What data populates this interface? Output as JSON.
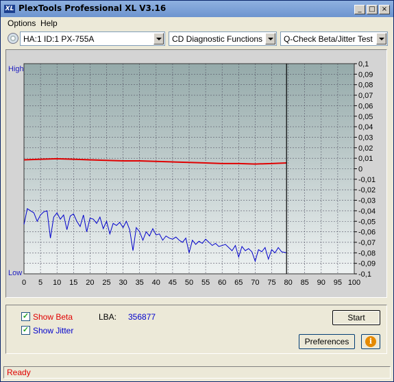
{
  "window": {
    "title": "PlexTools Professional XL V3.16",
    "logo_text": "XL",
    "controls": {
      "minimize": "_",
      "maximize": "□",
      "close": "×"
    }
  },
  "menu": {
    "items": [
      {
        "label": "Options",
        "accel": "O"
      },
      {
        "label": "Help",
        "accel": "H"
      }
    ]
  },
  "toolbar": {
    "drive": "HA:1 ID:1  PX-755A",
    "function": "CD Diagnostic Functions",
    "test": "Q-Check Beta/Jitter Test"
  },
  "chart": {
    "left_labels": {
      "top": "High",
      "bottom": "Low"
    },
    "colors": {
      "beta": "#e00000",
      "jitter": "#0000cc",
      "plot_top": "#95aaaa",
      "plot_bottom": "#eef2f2"
    }
  },
  "chart_data": {
    "type": "line",
    "x_ticks": [
      "0",
      "5",
      "10",
      "15",
      "20",
      "25",
      "30",
      "35",
      "40",
      "45",
      "50",
      "55",
      "60",
      "65",
      "70",
      "75",
      "80",
      "85",
      "90",
      "95",
      "100"
    ],
    "xlim": [
      0,
      100
    ],
    "ylim": [
      -0.1,
      0.1
    ],
    "y_ticks": [
      "0,1",
      "0,09",
      "0,08",
      "0,07",
      "0,06",
      "0,05",
      "0,04",
      "0,03",
      "0,02",
      "0,01",
      "0",
      "-0,01",
      "-0,02",
      "-0,03",
      "-0,04",
      "-0,05",
      "-0,06",
      "-0,07",
      "-0,08",
      "-0,09",
      "-0,1"
    ],
    "marker_x": 79.5,
    "grid": true,
    "series": [
      {
        "name": "Beta",
        "color": "#e00000",
        "x": [
          0,
          5,
          10,
          15,
          20,
          25,
          30,
          35,
          40,
          45,
          50,
          55,
          60,
          65,
          70,
          75,
          79.5
        ],
        "values": [
          0.0085,
          0.009,
          0.0095,
          0.009,
          0.0085,
          0.008,
          0.0075,
          0.0075,
          0.007,
          0.0065,
          0.006,
          0.0055,
          0.005,
          0.005,
          0.0045,
          0.005,
          0.0055
        ]
      },
      {
        "name": "Jitter",
        "color": "#0000cc",
        "x": [
          0,
          1,
          2,
          3,
          4,
          5,
          6,
          7,
          8,
          9,
          10,
          11,
          12,
          13,
          14,
          15,
          16,
          17,
          18,
          19,
          20,
          21,
          22,
          23,
          24,
          25,
          26,
          27,
          28,
          29,
          30,
          31,
          32,
          33,
          34,
          35,
          36,
          37,
          38,
          39,
          40,
          41,
          42,
          43,
          44,
          45,
          46,
          47,
          48,
          49,
          50,
          51,
          52,
          53,
          54,
          55,
          56,
          57,
          58,
          59,
          60,
          61,
          62,
          63,
          64,
          65,
          66,
          67,
          68,
          69,
          70,
          71,
          72,
          73,
          74,
          75,
          76,
          77,
          78,
          79.5
        ],
        "values": [
          -0.053,
          -0.038,
          -0.04,
          -0.042,
          -0.05,
          -0.044,
          -0.041,
          -0.04,
          -0.066,
          -0.046,
          -0.042,
          -0.048,
          -0.044,
          -0.058,
          -0.045,
          -0.043,
          -0.05,
          -0.055,
          -0.044,
          -0.06,
          -0.047,
          -0.048,
          -0.052,
          -0.046,
          -0.057,
          -0.05,
          -0.062,
          -0.052,
          -0.054,
          -0.051,
          -0.056,
          -0.05,
          -0.058,
          -0.078,
          -0.056,
          -0.06,
          -0.068,
          -0.06,
          -0.064,
          -0.057,
          -0.063,
          -0.062,
          -0.068,
          -0.064,
          -0.066,
          -0.067,
          -0.065,
          -0.068,
          -0.07,
          -0.066,
          -0.08,
          -0.068,
          -0.072,
          -0.069,
          -0.071,
          -0.067,
          -0.07,
          -0.073,
          -0.071,
          -0.074,
          -0.073,
          -0.072,
          -0.075,
          -0.078,
          -0.073,
          -0.084,
          -0.074,
          -0.078,
          -0.076,
          -0.079,
          -0.088,
          -0.077,
          -0.079,
          -0.075,
          -0.086,
          -0.077,
          -0.08,
          -0.075,
          -0.079,
          -0.08
        ]
      }
    ]
  },
  "controls": {
    "show_beta": {
      "label": "Show Beta",
      "checked": true,
      "color": "#e00000"
    },
    "show_jitter": {
      "label": "Show Jitter",
      "checked": true,
      "color": "#0000cc"
    },
    "lba_label": "LBA:",
    "lba_value": "356877",
    "start_button": "Start",
    "preferences_button": "Preferences",
    "info_icon": "i"
  },
  "status": {
    "text": "Ready"
  }
}
